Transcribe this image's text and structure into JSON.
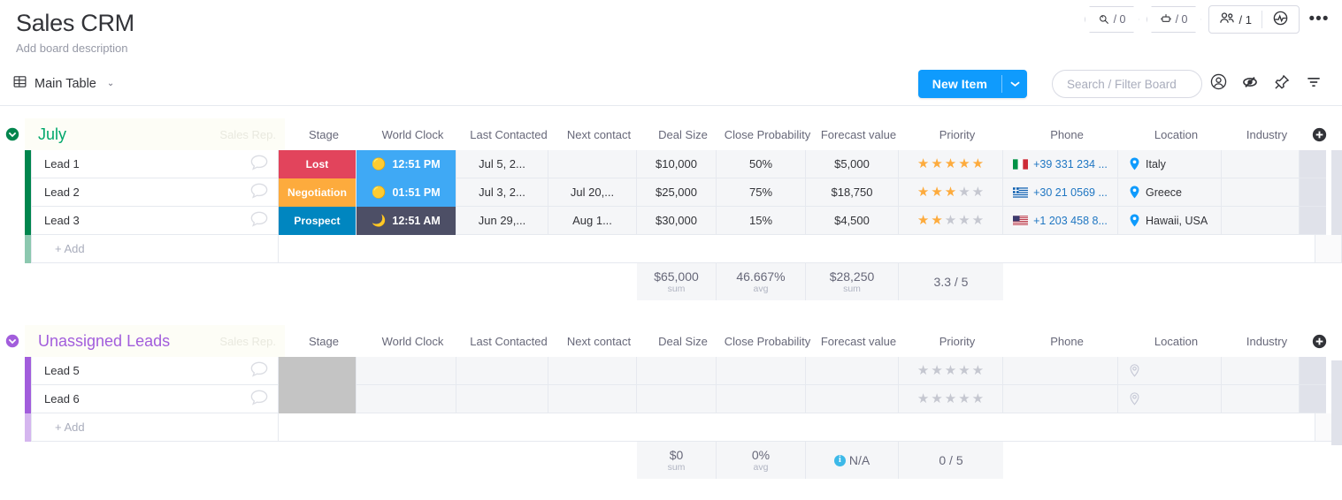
{
  "header": {
    "title": "Sales CRM",
    "description": "Add board description",
    "chips": [
      {
        "icon": "activity-log-icon",
        "value": "/ 0"
      },
      {
        "icon": "automations-robot-icon",
        "value": "/ 0"
      }
    ],
    "members": {
      "icon": "people-icon",
      "value": "/ 1"
    },
    "integrations_icon": "integrations-icon",
    "more_label": "•••"
  },
  "toolbar": {
    "view_label": "Main Table",
    "view_icon": "table-icon",
    "view_caret": "⌄",
    "new_item_label": "New Item",
    "new_item_caret": "⌄",
    "search_placeholder": "Search / Filter Board",
    "icons": [
      "person-circle-icon",
      "hide-eye-icon",
      "pin-icon",
      "filter-icon"
    ]
  },
  "columns": [
    "Sales Rep.",
    "Stage",
    "World Clock",
    "Last Contacted",
    "Next contact",
    "Deal Size",
    "Close Probability",
    "Forecast value",
    "Priority",
    "Phone",
    "Location",
    "Industry"
  ],
  "add_column_label": "+",
  "groups": [
    {
      "name": "July",
      "color": "#00854d",
      "title_color": "#00a76b",
      "sub_label": "Sales Rep.",
      "add_label": "+ Add",
      "rows": [
        {
          "name": "Lead 1",
          "stage": {
            "label": "Lost",
            "color": "#e2445c"
          },
          "clock": {
            "time": "12:51 PM",
            "period": "day",
            "color": "#3fa9f5",
            "icon": "sun-icon"
          },
          "last_contacted": "Jul 5, 2...",
          "next_contact": "",
          "deal_size": "$10,000",
          "close_probability": "50%",
          "forecast_value": "$5,000",
          "priority": 5,
          "phone": {
            "flag": "italy-flag-icon",
            "number": "+39 331 234 ..."
          },
          "location": "Italy",
          "industry": ""
        },
        {
          "name": "Lead 2",
          "stage": {
            "label": "Negotiation",
            "color": "#fdab3d"
          },
          "clock": {
            "time": "01:51 PM",
            "period": "day",
            "color": "#3fa9f5",
            "icon": "sun-icon"
          },
          "last_contacted": "Jul 3, 2...",
          "next_contact": "Jul 20,...",
          "deal_size": "$25,000",
          "close_probability": "75%",
          "forecast_value": "$18,750",
          "priority": 3,
          "phone": {
            "flag": "greece-flag-icon",
            "number": "+30 21 0569 ..."
          },
          "location": "Greece",
          "industry": ""
        },
        {
          "name": "Lead 3",
          "stage": {
            "label": "Prospect",
            "color": "#0086c0"
          },
          "clock": {
            "time": "12:51 AM",
            "period": "night",
            "color": "#4d4f66",
            "icon": "moon-icon"
          },
          "last_contacted": "Jun 29,...",
          "next_contact": "Aug 1...",
          "deal_size": "$30,000",
          "close_probability": "15%",
          "forecast_value": "$4,500",
          "priority": 2,
          "phone": {
            "flag": "usa-flag-icon",
            "number": "+1 203 458 8..."
          },
          "location": "Hawaii, USA",
          "industry": ""
        }
      ],
      "summary": {
        "deal_size": {
          "value": "$65,000",
          "label": "sum"
        },
        "close_probability": {
          "value": "46.667%",
          "label": "avg"
        },
        "forecast_value": {
          "value": "$28,250",
          "label": "sum"
        },
        "priority": {
          "value": "3.3 / 5",
          "label": ""
        }
      }
    },
    {
      "name": "Unassigned Leads",
      "color": "#a25ddc",
      "title_color": "#a25ddc",
      "sub_label": "Sales Rep.",
      "add_label": "+ Add",
      "rows": [
        {
          "name": "Lead 5",
          "stage": {
            "label": "",
            "color": "#c4c4c4"
          },
          "clock": {
            "time": "",
            "period": "none",
            "color": "",
            "icon": ""
          },
          "last_contacted": "",
          "next_contact": "",
          "deal_size": "",
          "close_probability": "",
          "forecast_value": "",
          "priority": 0,
          "phone": {
            "flag": "",
            "number": ""
          },
          "location": "",
          "industry": ""
        },
        {
          "name": "Lead 6",
          "stage": {
            "label": "",
            "color": "#c4c4c4"
          },
          "clock": {
            "time": "",
            "period": "none",
            "color": "",
            "icon": ""
          },
          "last_contacted": "",
          "next_contact": "",
          "deal_size": "",
          "close_probability": "",
          "forecast_value": "",
          "priority": 0,
          "phone": {
            "flag": "",
            "number": ""
          },
          "location": "",
          "industry": ""
        }
      ],
      "summary": {
        "deal_size": {
          "value": "$0",
          "label": "sum"
        },
        "close_probability": {
          "value": "0%",
          "label": "avg"
        },
        "forecast_value": {
          "value": "N/A",
          "label": "",
          "icon": "info-icon"
        },
        "priority": {
          "value": "0 / 5",
          "label": ""
        }
      }
    }
  ]
}
